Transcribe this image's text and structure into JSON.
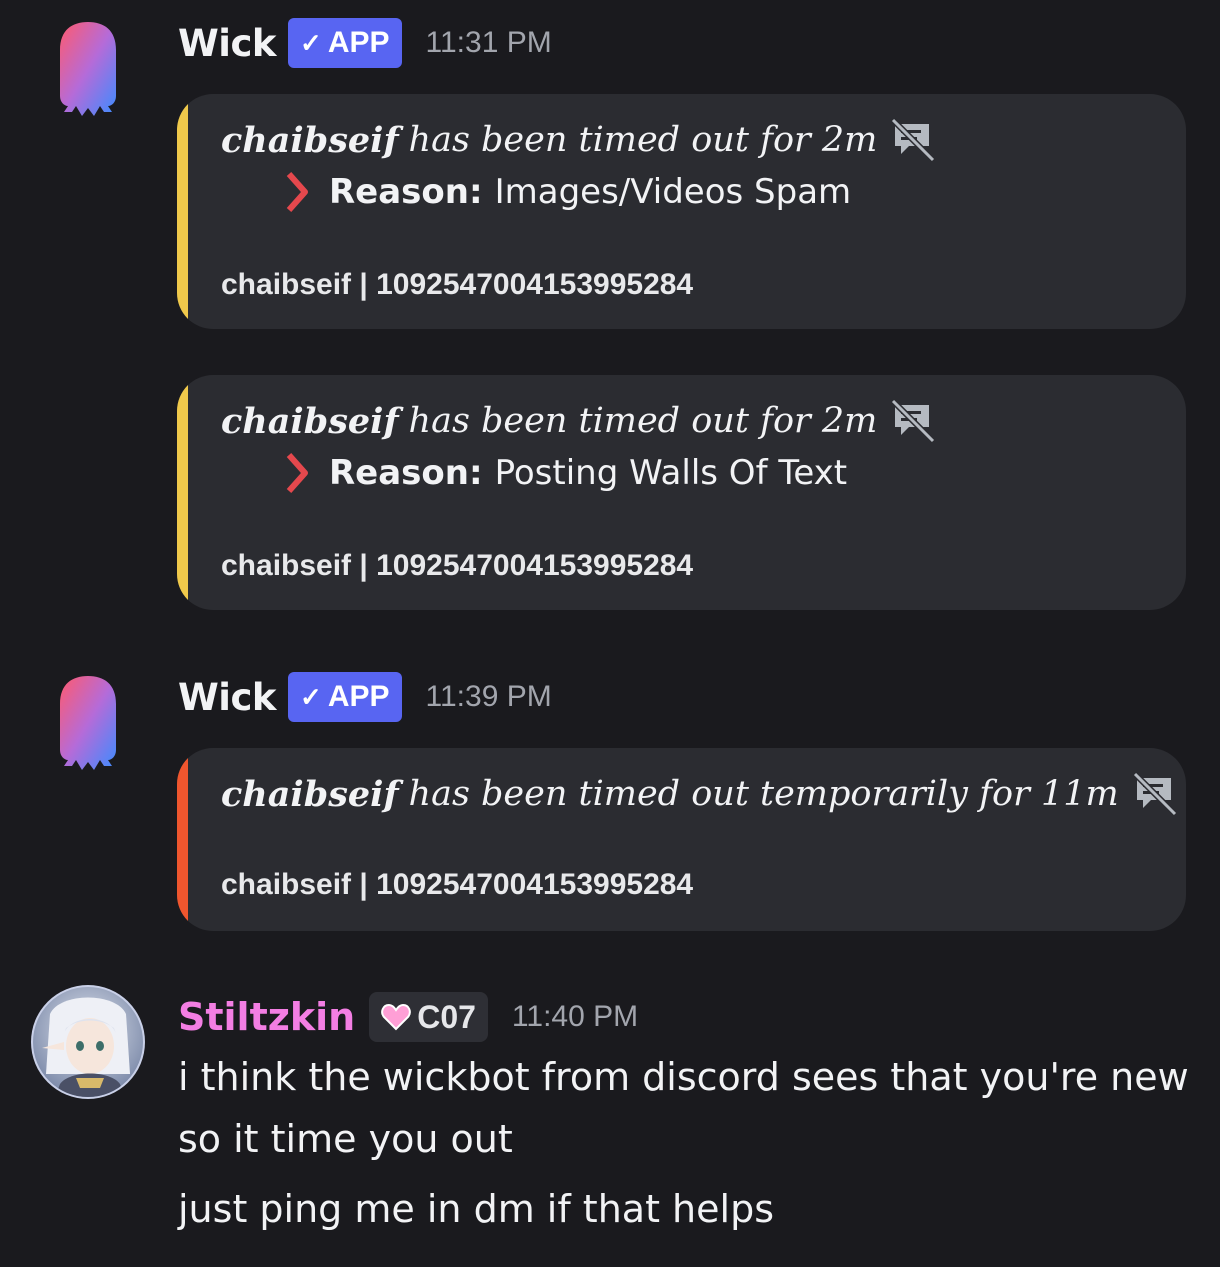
{
  "messages": [
    {
      "author": "Wick",
      "badge": "APP",
      "badge_check": "✓",
      "time": "11:31 PM",
      "embeds": [
        {
          "accent": "#f0c94b",
          "user": "chaibseif",
          "text": "has been timed out for 2m",
          "reason_label": "Reason:",
          "reason": "Images/Videos Spam",
          "footer": "chaibseif | 1092547004153995284"
        },
        {
          "accent": "#f0c94b",
          "user": "chaibseif",
          "text": "has been timed out for 2m",
          "reason_label": "Reason:",
          "reason": "Posting Walls Of Text",
          "footer": "chaibseif | 1092547004153995284"
        }
      ]
    },
    {
      "author": "Wick",
      "badge": "APP",
      "badge_check": "✓",
      "time": "11:39 PM",
      "embeds": [
        {
          "accent": "#f0562e",
          "user": "chaibseif",
          "text": "has been timed out temporarily for 11m",
          "footer": "chaibseif | 1092547004153995284"
        }
      ]
    },
    {
      "author": "Stiltzkin",
      "author_color": "#f37ee3",
      "tag": "C07",
      "time": "11:40 PM",
      "lines": [
        "i think the wickbot from discord sees that you're new",
        "so it time you out",
        "just ping me in dm if that helps"
      ]
    }
  ],
  "icons": {
    "bot_avatar": "wick-ghost-avatar",
    "muted": "muted-chat-icon",
    "chevron": "chevron-right-icon",
    "heart": "pink-heart-icon",
    "user_avatar": "anime-elf-avatar"
  },
  "colors": {
    "background": "#1a1a1e",
    "embed_bg": "#2b2c31",
    "app_badge": "#5865f2",
    "yellow_accent": "#f0c94b",
    "orange_accent": "#f0562e",
    "pink_name": "#f37ee3"
  }
}
